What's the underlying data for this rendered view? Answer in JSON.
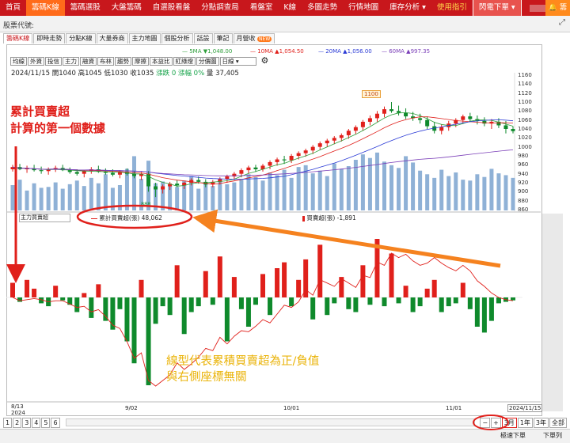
{
  "topnav": {
    "items": [
      "首頁",
      "籌碼K線",
      "籌碼選股",
      "大盤籌碼",
      "自選股看盤",
      "分點調查局",
      "看盤室",
      "K線",
      "多圖走勢",
      "行情地圖",
      "庫存分析 ▾",
      "使用指引",
      "閃電下單 ▾"
    ],
    "active_index": 1,
    "bell_label": "籌碼"
  },
  "search": {
    "label": "股票代號:",
    "expand": "⤢"
  },
  "subtabs": {
    "items": [
      "籌碼K線",
      "即時走勢",
      "分點K線",
      "大量券商",
      "主力地圖",
      "個股分析",
      "話設",
      "筆記",
      "月營收"
    ],
    "badge": "NEW"
  },
  "toolbar": {
    "buttons": [
      "均線",
      "外資",
      "投信",
      "主力",
      "融資",
      "布林",
      "趨勢",
      "摩擦",
      "本益比",
      "紅綠燈",
      "分價圖"
    ],
    "period": "日線"
  },
  "quote": {
    "date": "2024/11/15",
    "open_label": "開",
    "open": "1040",
    "high_label": "高",
    "high": "1045",
    "low_label": "低",
    "low": "1030",
    "close_label": "收",
    "close": "1035",
    "change": "漲跌 0",
    "pct": "漲幅 0%",
    "vol_label": "量",
    "volume": "37,405"
  },
  "ma_legend": [
    {
      "label": "5MA ▼1,048.00",
      "color": "#2e9e3a"
    },
    {
      "label": "10MA ▲1,054.50",
      "color": "#e0201b"
    },
    {
      "label": "20MA ▲1,056.00",
      "color": "#2b3bd6"
    },
    {
      "label": "60MA ▲997.35",
      "color": "#7b3fb8"
    }
  ],
  "price_peak_label": "1100",
  "price_low_label": "888",
  "lower_panel": {
    "selector": "主力買賣超",
    "legend_cum": "累計買賣超(張) 48,062",
    "legend_daily": "買賣超(張) -1,891"
  },
  "annotations": {
    "top_red_line1": "累計買賣超",
    "top_red_line2": "計算的第一個數據",
    "bottom_line1": "線型代表累積買賣超為正/負值",
    "bottom_line2": "與右側座標無關"
  },
  "x_axis": {
    "first": "8/13",
    "first_year": "2024",
    "labels": [
      "9/02",
      "10/01",
      "11/01"
    ],
    "last": "2024/11/15"
  },
  "pager": {
    "pages": [
      "1",
      "2",
      "3",
      "4",
      "5",
      "6"
    ],
    "range_selected": "3月",
    "ranges": [
      "1年",
      "3年"
    ],
    "all": "全部"
  },
  "bottom_buttons": {
    "quick": "極速下單",
    "next": "下單列"
  },
  "chart_data": {
    "type": "candlestick",
    "y_ticks": [
      1160,
      1140,
      1120,
      1100,
      1080,
      1060,
      1040,
      1020,
      1000,
      980,
      960,
      940,
      920,
      900,
      880,
      860
    ],
    "ohlc": [
      [
        950,
        960,
        945,
        955
      ],
      [
        955,
        962,
        948,
        950
      ],
      [
        950,
        958,
        942,
        952
      ],
      [
        952,
        960,
        945,
        948
      ],
      [
        948,
        956,
        940,
        946
      ],
      [
        946,
        954,
        938,
        950
      ],
      [
        950,
        958,
        944,
        953
      ],
      [
        953,
        960,
        946,
        948
      ],
      [
        948,
        954,
        940,
        944
      ],
      [
        944,
        950,
        936,
        940
      ],
      [
        940,
        948,
        932,
        946
      ],
      [
        946,
        955,
        940,
        950
      ],
      [
        950,
        958,
        942,
        945
      ],
      [
        945,
        952,
        938,
        942
      ],
      [
        942,
        950,
        934,
        938
      ],
      [
        938,
        948,
        930,
        944
      ],
      [
        944,
        952,
        936,
        940
      ],
      [
        940,
        946,
        930,
        935
      ],
      [
        935,
        944,
        926,
        940
      ],
      [
        940,
        946,
        900,
        912
      ],
      [
        912,
        920,
        888,
        905
      ],
      [
        905,
        916,
        896,
        912
      ],
      [
        912,
        922,
        904,
        918
      ],
      [
        918,
        926,
        910,
        914
      ],
      [
        914,
        922,
        906,
        920
      ],
      [
        920,
        930,
        914,
        926
      ],
      [
        926,
        934,
        918,
        922
      ],
      [
        922,
        928,
        910,
        916
      ],
      [
        916,
        926,
        910,
        922
      ],
      [
        922,
        932,
        916,
        928
      ],
      [
        928,
        938,
        920,
        934
      ],
      [
        934,
        944,
        926,
        940
      ],
      [
        940,
        952,
        932,
        948
      ],
      [
        948,
        958,
        940,
        954
      ],
      [
        954,
        960,
        944,
        950
      ],
      [
        950,
        962,
        945,
        958
      ],
      [
        958,
        970,
        950,
        966
      ],
      [
        966,
        976,
        958,
        972
      ],
      [
        972,
        980,
        962,
        970
      ],
      [
        970,
        984,
        964,
        980
      ],
      [
        980,
        990,
        972,
        986
      ],
      [
        986,
        996,
        978,
        992
      ],
      [
        992,
        1004,
        984,
        1000
      ],
      [
        1000,
        1012,
        994,
        1008
      ],
      [
        1008,
        1018,
        1000,
        1014
      ],
      [
        1014,
        1024,
        1006,
        1020
      ],
      [
        1020,
        1030,
        1012,
        1026
      ],
      [
        1026,
        1040,
        1018,
        1036
      ],
      [
        1036,
        1048,
        1028,
        1044
      ],
      [
        1044,
        1060,
        1036,
        1056
      ],
      [
        1056,
        1070,
        1048,
        1064
      ],
      [
        1064,
        1080,
        1056,
        1074
      ],
      [
        1074,
        1090,
        1066,
        1084
      ],
      [
        1084,
        1100,
        1076,
        1080
      ],
      [
        1080,
        1092,
        1070,
        1076
      ],
      [
        1076,
        1086,
        1062,
        1068
      ],
      [
        1068,
        1078,
        1058,
        1064
      ],
      [
        1064,
        1074,
        1052,
        1060
      ],
      [
        1060,
        1068,
        1040,
        1046
      ],
      [
        1046,
        1056,
        1030,
        1036
      ],
      [
        1036,
        1050,
        1028,
        1044
      ],
      [
        1044,
        1058,
        1036,
        1052
      ],
      [
        1052,
        1064,
        1044,
        1060
      ],
      [
        1060,
        1072,
        1052,
        1068
      ],
      [
        1068,
        1076,
        1056,
        1062
      ],
      [
        1062,
        1070,
        1050,
        1058
      ],
      [
        1058,
        1066,
        1046,
        1052
      ],
      [
        1052,
        1062,
        1040,
        1056
      ],
      [
        1056,
        1064,
        1042,
        1048
      ],
      [
        1048,
        1058,
        1030,
        1040
      ],
      [
        1040,
        1046,
        1030,
        1035
      ]
    ],
    "volumes": [
      28,
      34,
      22,
      30,
      25,
      26,
      31,
      24,
      29,
      33,
      27,
      36,
      30,
      40,
      25,
      28,
      46,
      60,
      35,
      55,
      30,
      32,
      28,
      26,
      33,
      38,
      24,
      30,
      27,
      35,
      29,
      31,
      34,
      40,
      37,
      33,
      42,
      39,
      45,
      36,
      48,
      50,
      41,
      44,
      38,
      52,
      46,
      49,
      56,
      62,
      58,
      64,
      54,
      50,
      47,
      60,
      53,
      44,
      40,
      36,
      45,
      38,
      42,
      34,
      33,
      40,
      37,
      46,
      41,
      39,
      36
    ],
    "daily_net": [
      10,
      -3,
      12,
      6,
      -4,
      -6,
      8,
      -2,
      -5,
      -10,
      3,
      -14,
      9,
      -16,
      -22,
      -8,
      -30,
      -45,
      12,
      -60,
      -18,
      -6,
      -12,
      22,
      -25,
      -10,
      -6,
      18,
      -5,
      28,
      -30,
      14,
      -8,
      -20,
      -5,
      16,
      -12,
      20,
      24,
      -6,
      12,
      26,
      -15,
      36,
      -12,
      -4,
      14,
      -8,
      -10,
      22,
      -5,
      40,
      -6,
      30,
      -4,
      8,
      -10,
      -6,
      6,
      12,
      -10,
      -6,
      -4,
      10,
      -8,
      -20,
      -24,
      -16,
      -4,
      -3,
      -2
    ],
    "cum_line": [
      0,
      -6,
      -4,
      -2,
      -4,
      -8,
      -6,
      -6,
      -12,
      -18,
      -16,
      -26,
      -22,
      -34,
      -50,
      -56,
      -80,
      -110,
      -100,
      -150,
      -160,
      -150,
      -140,
      -118,
      -130,
      -120,
      -108,
      -92,
      -96,
      -72,
      -84,
      -70,
      -60,
      -62,
      -52,
      -40,
      -46,
      -30,
      -14,
      -18,
      -8,
      14,
      4,
      32,
      26,
      20,
      34,
      26,
      18,
      40,
      36,
      64,
      58,
      80,
      72,
      78,
      66,
      58,
      62,
      72,
      62,
      54,
      48,
      58,
      48,
      30,
      20,
      8,
      0,
      -4,
      -6
    ],
    "ma5_color": "#2e9e3a",
    "ma10_color": "#e0201b",
    "ma20_color": "#2b3bd6",
    "ma60_color": "#7b3fb8",
    "up_color": "#e0201b",
    "down_color": "#0f8a2c",
    "volume_color": "#8fb1d6"
  }
}
